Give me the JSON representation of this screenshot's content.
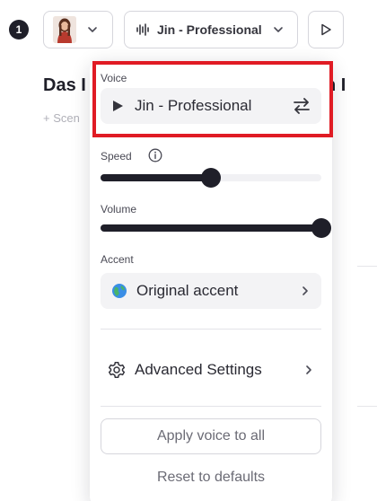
{
  "toolbar": {
    "step_number": "1",
    "voice_name": "Jin - Professional",
    "icons": [
      "avatar",
      "chevron-down-icon",
      "waveform-icon",
      "play-icon"
    ]
  },
  "scene": {
    "title_left": "Das I",
    "title_right": "n I",
    "add_scene": "+ Scen"
  },
  "panel": {
    "voice": {
      "label": "Voice",
      "current": "Jin - Professional",
      "icons": [
        "play-icon",
        "swap-icon"
      ]
    },
    "speed": {
      "label": "Speed",
      "value": 0.5,
      "icon": "info-icon"
    },
    "volume": {
      "label": "Volume",
      "value": 1.0
    },
    "accent": {
      "label": "Accent",
      "value": "Original accent",
      "icon": "globe-icon"
    },
    "advanced": {
      "label": "Advanced Settings",
      "icon": "gear-icon"
    },
    "apply_label": "Apply voice to all",
    "reset_label": "Reset to defaults"
  },
  "colors": {
    "accent_dark": "#1f1f29",
    "highlight_red": "#e01b24",
    "field_bg": "#f3f3f5",
    "muted_text": "#6b6b75"
  }
}
